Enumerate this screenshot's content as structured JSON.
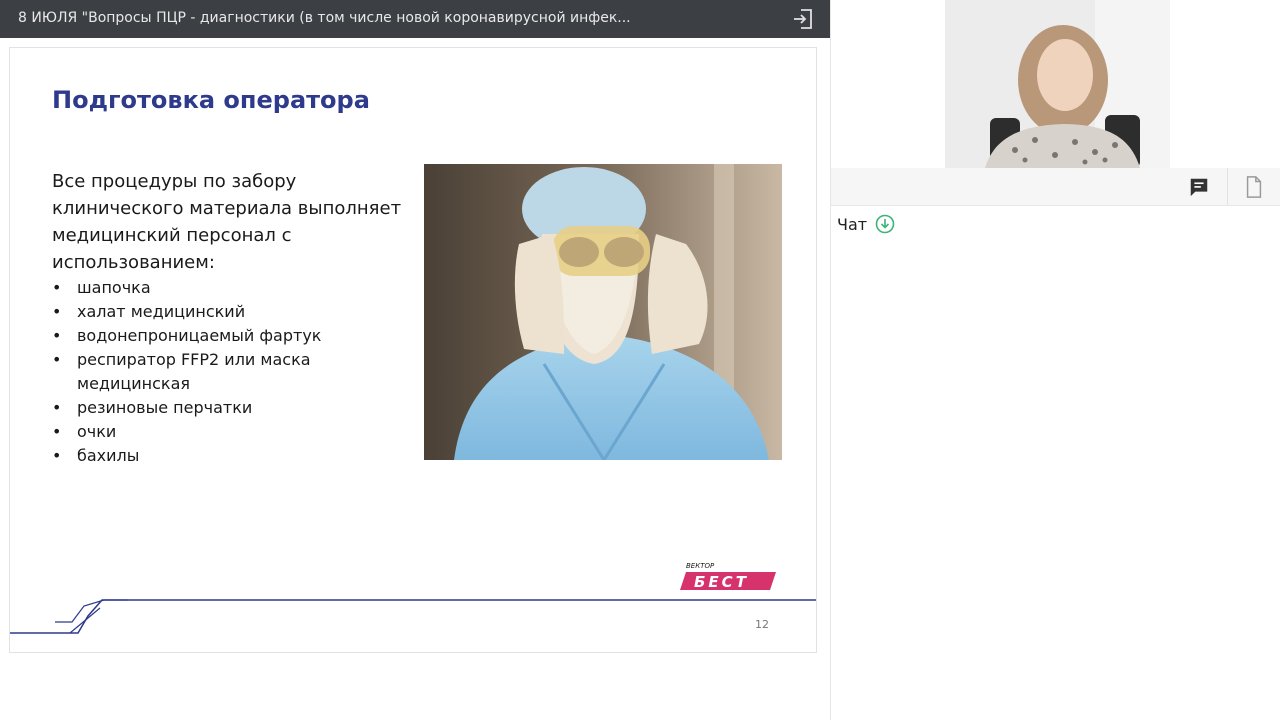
{
  "header": {
    "title": "8 ИЮЛЯ \"Вопросы ПЦР - диагностики (в том числе новой коронавирусной инфек...",
    "exit_icon": "exit-icon"
  },
  "slide": {
    "title": "Подготовка оператора",
    "intro": "Все процедуры по забору клинического материала выполняет медицинский персонал с использованием:",
    "bullets": [
      "шапочка",
      "халат медицинский",
      "водонепроницаемый фартук",
      "респиратор FFP2 или маска медицинская",
      "резиновые перчатки",
      "очки",
      "бахилы"
    ],
    "bullet_glyph": "•",
    "brand_small": "ВЕКТОР",
    "brand_big": "БЕСТ",
    "page_number": "12",
    "title_color": "#2e3a8c"
  },
  "side": {
    "chat_label": "Чат",
    "chat_icon": "chat-icon",
    "files_icon": "file-icon",
    "download_icon": "download-icon"
  }
}
